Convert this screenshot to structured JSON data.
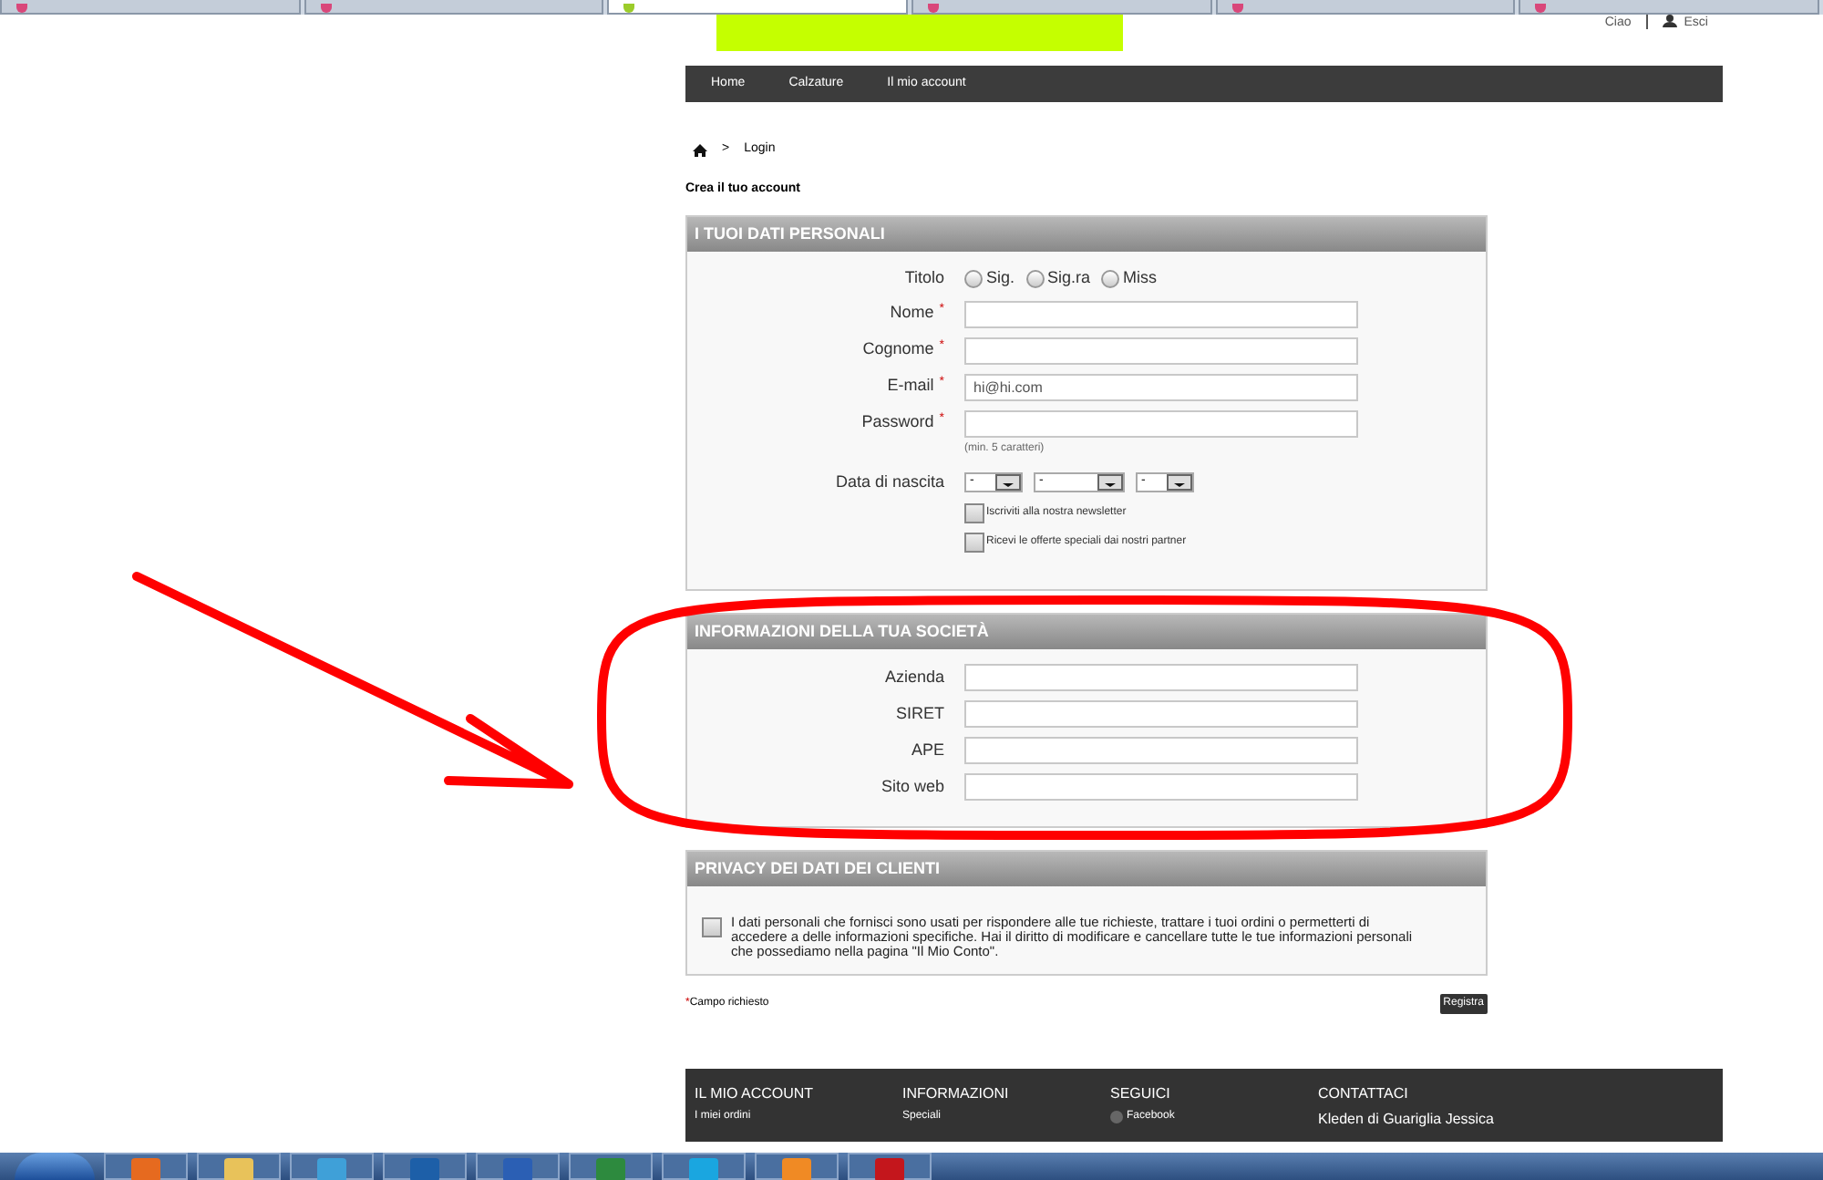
{
  "browser_tabs": [
    {
      "selected": false
    },
    {
      "selected": false
    },
    {
      "selected": true
    },
    {
      "selected": false
    },
    {
      "selected": false
    },
    {
      "selected": false
    }
  ],
  "header": {
    "greeting": "Ciao",
    "logout": "Esci"
  },
  "nav": [
    "Home",
    "Calzature",
    "Il mio account"
  ],
  "breadcrumb": {
    "separator": ">",
    "current": "Login"
  },
  "page_title": "Crea il tuo account",
  "personal": {
    "title": "I TUOI DATI PERSONALI",
    "title_label": "Titolo",
    "titles": [
      {
        "label": "Sig.",
        "selected": false
      },
      {
        "label": "Sig.ra",
        "selected": false
      },
      {
        "label": "Miss",
        "selected": false
      }
    ],
    "fields": [
      {
        "label": "Nome",
        "required_mark": "*"
      },
      {
        "label": "Cognome",
        "required_mark": "*"
      },
      {
        "label": "E-mail",
        "required_mark": "*",
        "value": "hi@hi.com"
      },
      {
        "label": "Password",
        "required_mark": "*",
        "hint": "(min. 5 caratteri)"
      }
    ],
    "birth_label": "Data di nascita",
    "birth": [
      "-",
      "-",
      "-"
    ],
    "options": [
      {
        "label": "Iscriviti alla nostra newsletter",
        "checked": false
      },
      {
        "label": "Ricevi le offerte speciali dai nostri partner",
        "checked": false
      }
    ]
  },
  "company": {
    "title": "INFORMAZIONI DELLA TUA SOCIETÀ",
    "fields": [
      {
        "label": "Azienda"
      },
      {
        "label": "SIRET"
      },
      {
        "label": "APE"
      },
      {
        "label": "Sito web"
      }
    ]
  },
  "privacy": {
    "title": "PRIVACY DEI DATI DEI CLIENTI",
    "checked": false,
    "text": "I dati personali che fornisci sono usati per rispondere alle tue richieste, trattare i tuoi ordini o permetterti di accedere a delle informazioni specifiche. Hai il diritto di modificare e cancellare tutte le tue informazioni personali che possediamo nella pagina \"Il Mio Conto\"."
  },
  "required_star": "*",
  "required_note": "Campo richiesto",
  "submit": "Registra",
  "footer": [
    {
      "title": "IL MIO ACCOUNT",
      "item": "I miei ordini"
    },
    {
      "title": "INFORMAZIONI",
      "item": "Speciali"
    },
    {
      "title": "SEGUICI",
      "item": "Facebook"
    },
    {
      "title": "CONTATTACI",
      "item": "Kleden di Guariglia Jessica"
    }
  ],
  "taskbar": [
    {
      "kind": "start"
    },
    {
      "kind": "browser"
    },
    {
      "kind": "folder"
    },
    {
      "kind": "windows"
    },
    {
      "kind": "photo"
    },
    {
      "kind": "word"
    },
    {
      "kind": "sheet"
    },
    {
      "kind": "chat"
    },
    {
      "kind": "player"
    },
    {
      "kind": "ftp"
    }
  ]
}
